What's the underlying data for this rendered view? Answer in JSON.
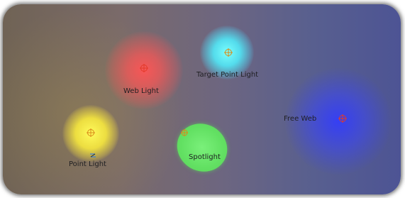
{
  "scene": {
    "lights": [
      {
        "id": "web-light",
        "label": "Web Light",
        "color": "#ff5a5a"
      },
      {
        "id": "target-point-light",
        "label": "Target Point Light",
        "color": "#4df4ff"
      },
      {
        "id": "point-light",
        "label": "Point Light",
        "color": "#fff23d"
      },
      {
        "id": "spotlight",
        "label": "Spotlight",
        "color": "#6fe86f"
      },
      {
        "id": "free-web",
        "label": "Free Web",
        "color": "#3b47ff"
      }
    ]
  },
  "icons": {
    "crosshair": "crosshair-target-icon",
    "light-direction": "light-direction-icon"
  },
  "colors": {
    "crosshair_red": "#e23a2a",
    "crosshair_orange": "#d98a1a",
    "background_left": "#706355",
    "background_right": "#4d5494"
  }
}
